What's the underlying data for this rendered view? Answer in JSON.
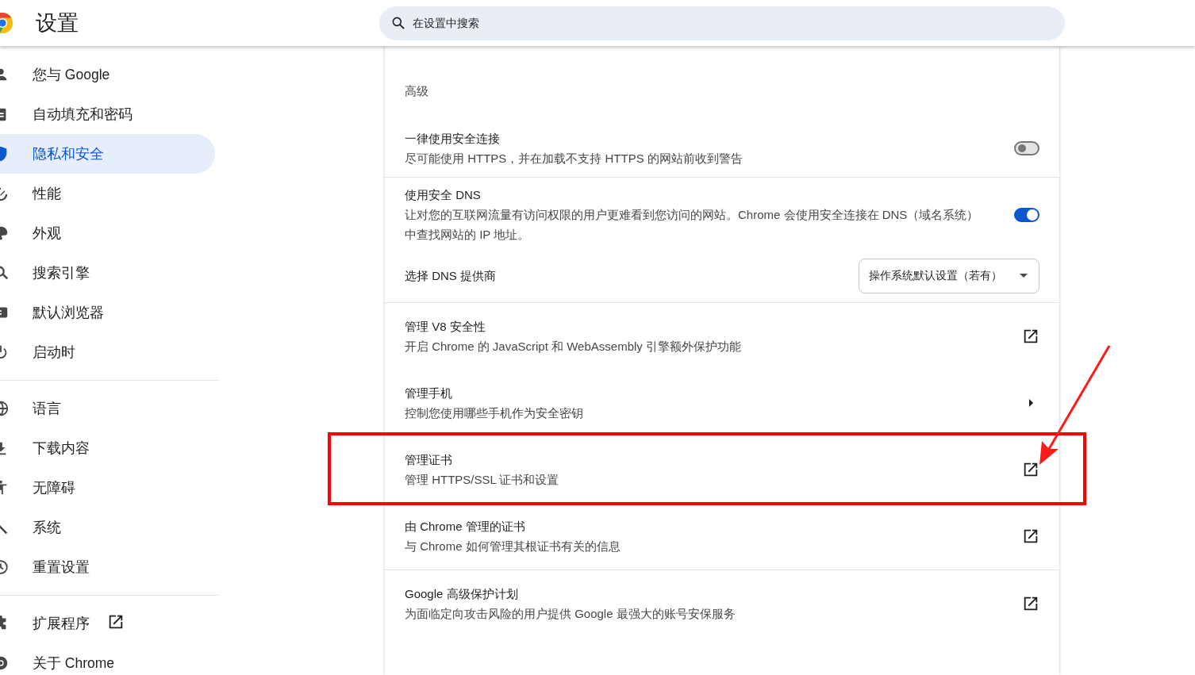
{
  "header": {
    "title": "设置",
    "search": {
      "placeholder": "在设置中搜索"
    }
  },
  "sidebar": {
    "groups": [
      [
        {
          "label": "您与 Google",
          "selected": false,
          "external": false
        },
        {
          "label": "自动填充和密码",
          "selected": false,
          "external": false
        },
        {
          "label": "隐私和安全",
          "selected": true,
          "external": false
        },
        {
          "label": "性能",
          "selected": false,
          "external": false
        },
        {
          "label": "外观",
          "selected": false,
          "external": false
        },
        {
          "label": "搜索引擎",
          "selected": false,
          "external": false
        },
        {
          "label": "默认浏览器",
          "selected": false,
          "external": false
        },
        {
          "label": "启动时",
          "selected": false,
          "external": false
        }
      ],
      [
        {
          "label": "语言",
          "selected": false,
          "external": false
        },
        {
          "label": "下载内容",
          "selected": false,
          "external": false
        },
        {
          "label": "无障碍",
          "selected": false,
          "external": false
        },
        {
          "label": "系统",
          "selected": false,
          "external": false
        },
        {
          "label": "重置设置",
          "selected": false,
          "external": false
        }
      ],
      [
        {
          "label": "扩展程序",
          "selected": false,
          "external": true
        },
        {
          "label": "关于 Chrome",
          "selected": false,
          "external": false
        }
      ]
    ]
  },
  "main": {
    "section_title": "高级",
    "rows": [
      {
        "kind": "toggle",
        "title": "一律使用安全连接",
        "description": "尽可能使用 HTTPS，并在加载不支持 HTTPS 的网站前收到警告",
        "on": false,
        "divider": true
      },
      {
        "kind": "toggle",
        "title": "使用安全 DNS",
        "description": "让对您的互联网流量有访问权限的用户更难看到您访问的网站。Chrome 会使用安全连接在 DNS（域名系统）中查找网站的 IP 地址。",
        "on": true,
        "divider": false
      },
      {
        "kind": "select",
        "title": "选择 DNS 提供商",
        "value": "操作系统默认设置（若有）",
        "divider": true
      },
      {
        "kind": "external",
        "title": "管理 V8 安全性",
        "description": "开启 Chrome 的 JavaScript 和 WebAssembly 引擎额外保护功能",
        "divider": false
      },
      {
        "kind": "arrow",
        "title": "管理手机",
        "description": "控制您使用哪些手机作为安全密钥",
        "divider": false
      },
      {
        "kind": "external",
        "title": "管理证书",
        "description": "管理 HTTPS/SSL 证书和设置",
        "divider": false
      },
      {
        "kind": "external",
        "title": "由 Chrome 管理的证书",
        "description": "与 Chrome 如何管理其根证书有关的信息",
        "divider": true
      },
      {
        "kind": "external",
        "title": "Google 高级保护计划",
        "description": "为面临定向攻击风险的用户提供 Google 最强大的账号安保服务",
        "divider": false
      }
    ]
  }
}
